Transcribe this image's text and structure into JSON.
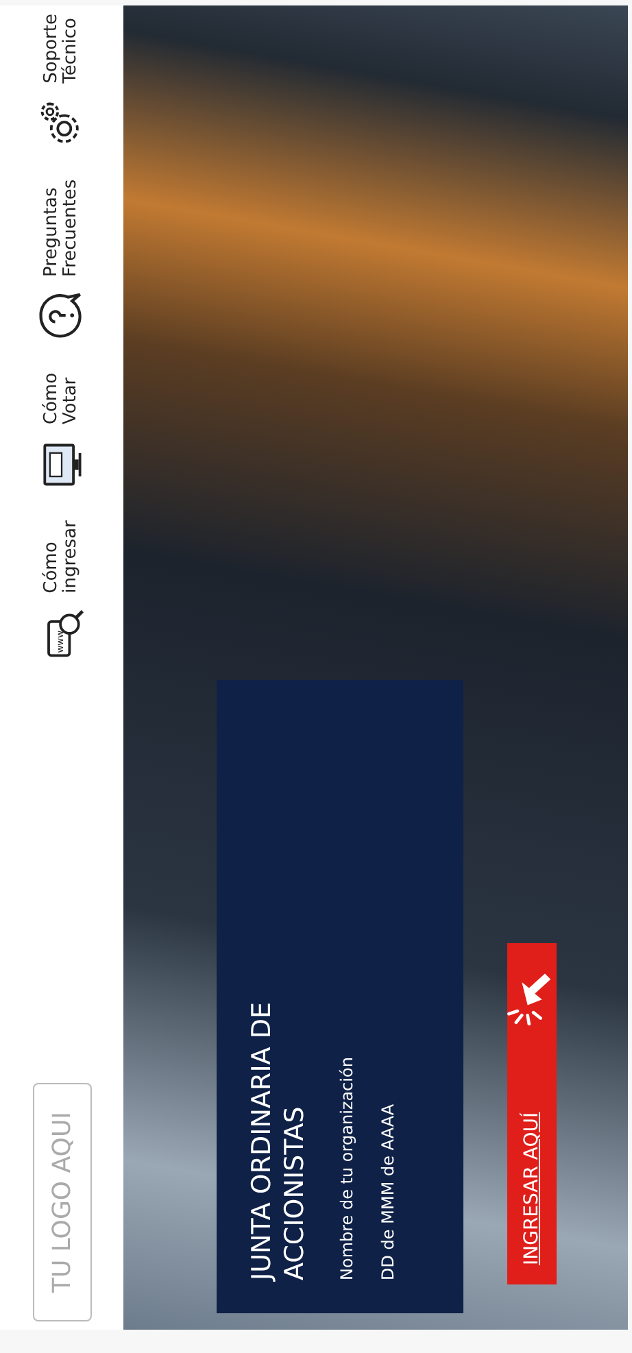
{
  "header": {
    "logo": "TU LOGO AQUI",
    "nav": [
      {
        "kind": "www",
        "label": "Cómo\ningresar"
      },
      {
        "kind": "vote",
        "label": "Cómo\nVotar"
      },
      {
        "kind": "question",
        "label": "Preguntas\nFrecuentes"
      },
      {
        "kind": "gear",
        "label": "Soporte\nTécnico"
      }
    ]
  },
  "hero": {
    "title": "JUNTA ORDINARIA DE ACCIONISTAS",
    "organization": "Nombre de tu organización",
    "date": "DD de MMM de AAAA",
    "button": "INGRESAR AQUÍ"
  }
}
